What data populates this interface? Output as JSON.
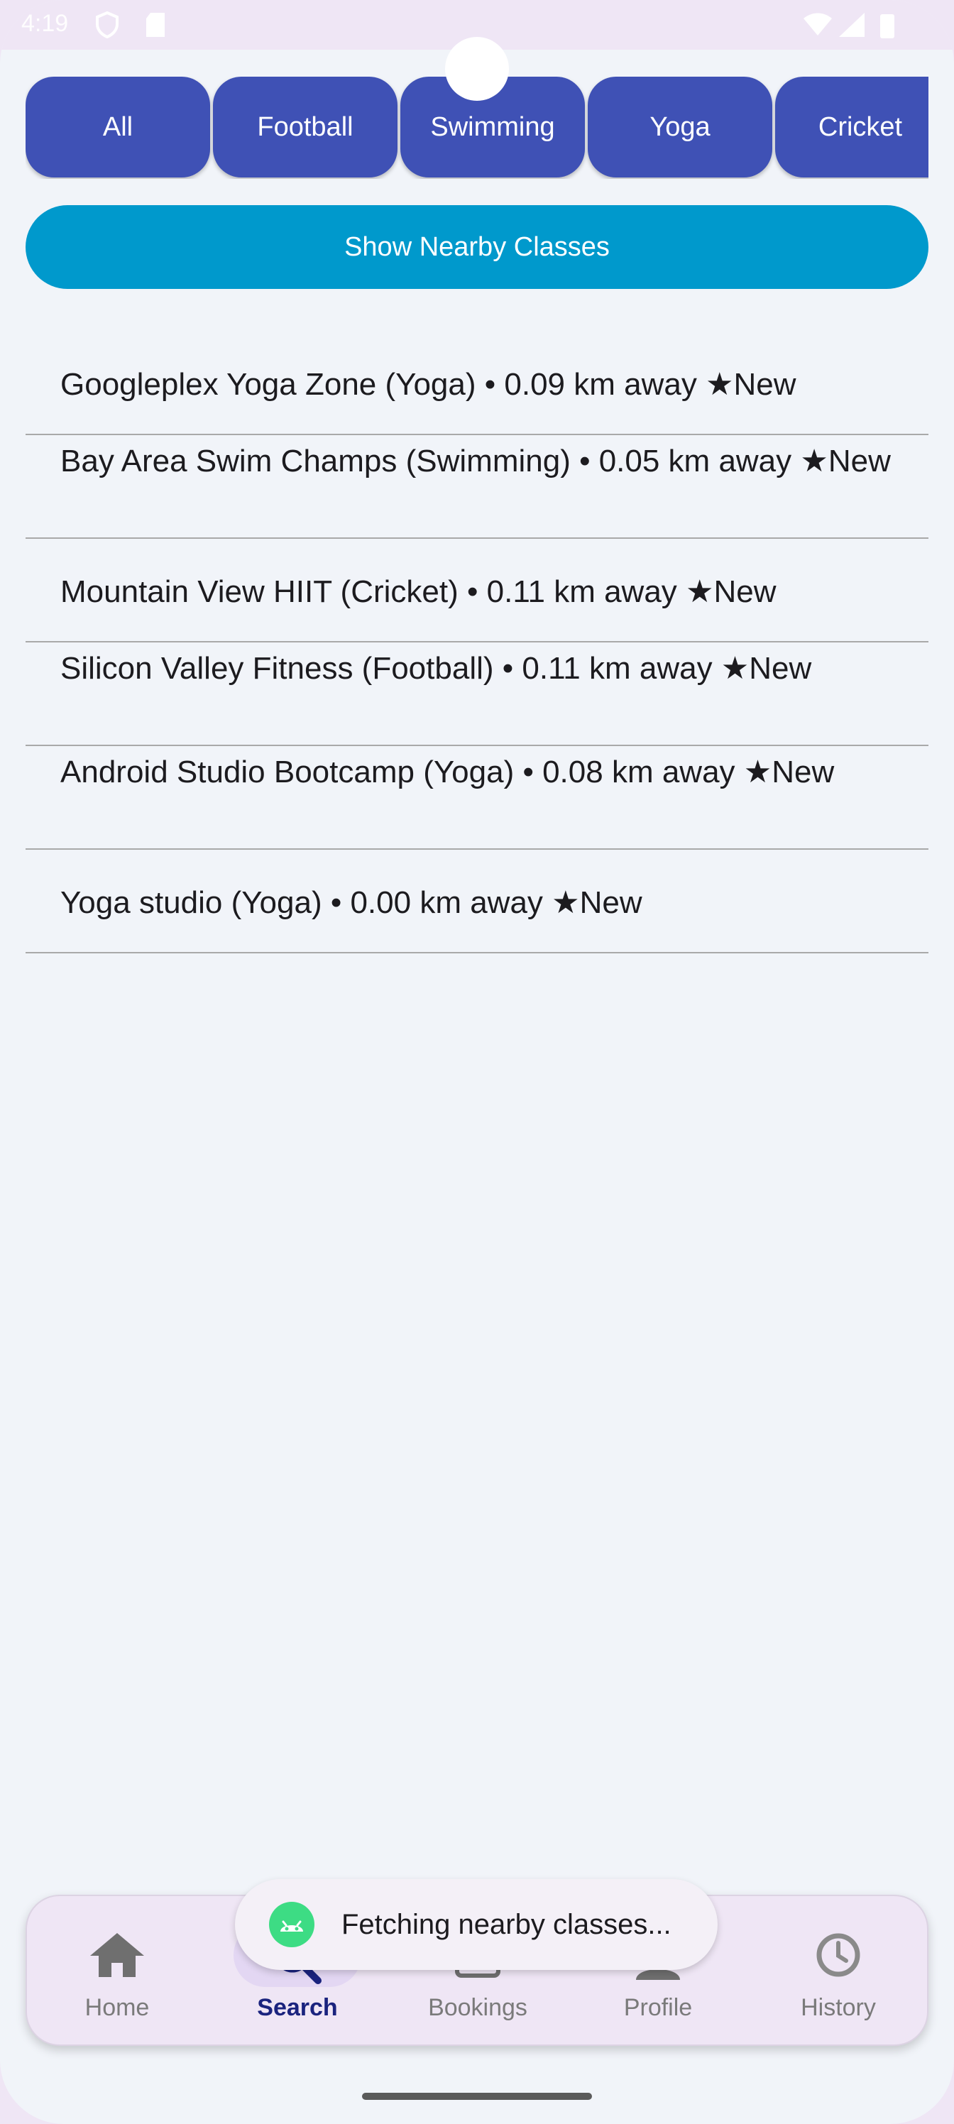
{
  "status_bar": {
    "time": "4:19"
  },
  "chips": [
    {
      "label": "All"
    },
    {
      "label": "Football"
    },
    {
      "label": "Swimming"
    },
    {
      "label": "Yoga"
    },
    {
      "label": "Cricket"
    }
  ],
  "show_nearby_button": "Show Nearby Classes",
  "classes": [
    {
      "text": "Googleplex Yoga Zone (Yoga) • 0.09 km away ★New"
    },
    {
      "text": "Bay Area Swim Champs (Swimming) • 0.05 km away ★New"
    },
    {
      "text": "Mountain View HIIT (Cricket) • 0.11 km away ★New"
    },
    {
      "text": "Silicon Valley Fitness (Football) • 0.11 km away ★New"
    },
    {
      "text": "Android Studio Bootcamp (Yoga) • 0.08 km away ★New"
    },
    {
      "text": "Yoga studio (Yoga) • 0.00 km away ★New"
    }
  ],
  "toast": {
    "text": "Fetching nearby classes...",
    "icon": "android-icon"
  },
  "bottom_nav": {
    "items": [
      {
        "label": "Home",
        "icon": "home-icon"
      },
      {
        "label": "Search",
        "icon": "search-icon",
        "active": true
      },
      {
        "label": "Bookings",
        "icon": "bookings-icon"
      },
      {
        "label": "Profile",
        "icon": "profile-icon"
      },
      {
        "label": "History",
        "icon": "history-icon"
      }
    ]
  },
  "colors": {
    "chip": "#3f51b5",
    "show_button": "#0099cc",
    "background": "#f1f4f9",
    "nav_background": "#efe6f5",
    "active_nav_label": "#1a237e"
  }
}
